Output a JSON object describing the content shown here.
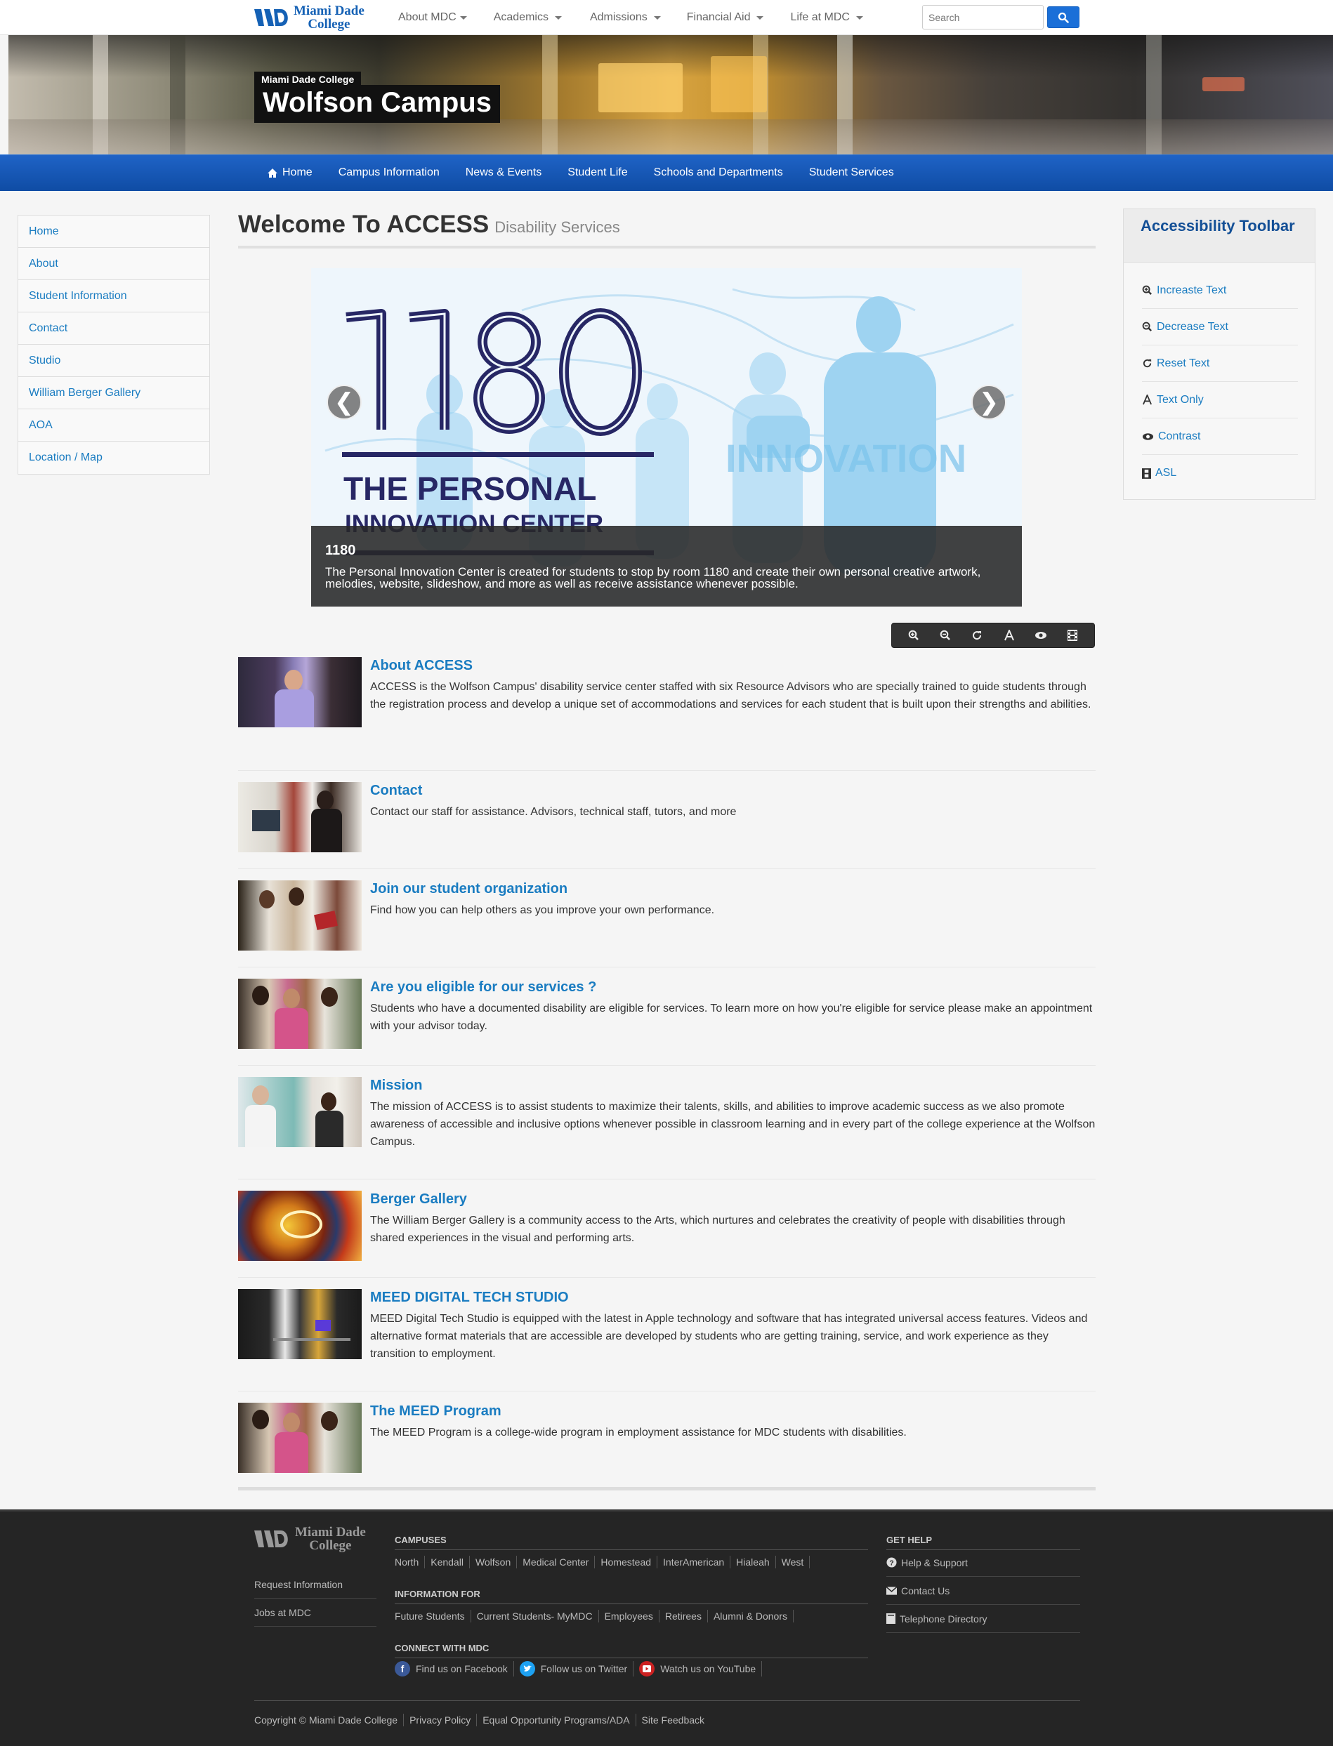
{
  "brand": {
    "line1": "Miami Dade",
    "line2": "College"
  },
  "topnav": [
    {
      "label": "About MDC"
    },
    {
      "label": "Academics"
    },
    {
      "label": "Admissions"
    },
    {
      "label": "Financial Aid"
    },
    {
      "label": "Life at MDC"
    }
  ],
  "search": {
    "placeholder": "Search"
  },
  "banner": {
    "small": "Miami Dade College",
    "title": "Wolfson Campus"
  },
  "mainnav": [
    {
      "label": "Home"
    },
    {
      "label": "Campus Information"
    },
    {
      "label": "News & Events"
    },
    {
      "label": "Student Life"
    },
    {
      "label": "Schools and Departments"
    },
    {
      "label": "Student Services"
    }
  ],
  "sidebar": [
    {
      "label": "Home"
    },
    {
      "label": "About"
    },
    {
      "label": "Student Information"
    },
    {
      "label": "Contact"
    },
    {
      "label": "Studio"
    },
    {
      "label": "William Berger Gallery"
    },
    {
      "label": "AOA"
    },
    {
      "label": "Location / Map"
    }
  ],
  "heading": {
    "title": "Welcome To ACCESS",
    "subtitle": "Disability Services"
  },
  "carousel": {
    "number": "1180",
    "art_line1": "THE PERSONAL",
    "art_line2": "INNOVATION CENTER",
    "caption_title": "1180",
    "caption_text": "The Personal Innovation Center is created for students to stop by room 1180 and create their own personal creative artwork, melodies, website, slideshow, and more as well as receive assistance whenever possible.",
    "prev": "❮",
    "next": "❯"
  },
  "items": [
    {
      "title": "About ACCESS",
      "text": "ACCESS is the Wolfson Campus' disability service center staffed with six Resource Advisors who are specially trained to guide students through the registration process and develop a unique set of accommodations and services for each student that is built upon their strengths and abilities."
    },
    {
      "title": "Contact",
      "text": "Contact our staff for assistance. Advisors, technical staff, tutors, and more"
    },
    {
      "title": "Join our student organization",
      "text": "Find how you can help others as you improve your own performance."
    },
    {
      "title": "Are you eligible for our services ?",
      "text": "Students who have a documented disability are eligible for services. To learn more on how you're eligible for service please make an appointment with your advisor today."
    },
    {
      "title": "Mission",
      "text": "The mission of ACCESS is to assist students to maximize their talents, skills, and abilities to improve academic success as we also promote awareness of accessible and inclusive options whenever possible in classroom learning and in every part of the college experience at the Wolfson Campus."
    },
    {
      "title": "Berger Gallery",
      "text": "The William Berger Gallery is a community access to the Arts, which nurtures and celebrates the creativity of people with disabilities through shared experiences in the visual and performing arts."
    },
    {
      "title": "MEED DIGITAL TECH STUDIO",
      "text": "MEED Digital Tech Studio is equipped with the latest in Apple technology and software that has integrated universal access features. Videos and alternative format materials that are accessible are developed by students who are getting training, service, and work experience as they transition to employment."
    },
    {
      "title": "The MEED Program",
      "text": "The MEED Program is a college-wide program in employment assistance for MDC students with disabilities."
    }
  ],
  "toolbar": {
    "title": "Accessibility Toolbar",
    "items": [
      {
        "label": "Increaste Text",
        "icon": "zoom-in-icon"
      },
      {
        "label": "Decrease Text",
        "icon": "zoom-out-icon"
      },
      {
        "label": "Reset Text",
        "icon": "refresh-icon"
      },
      {
        "label": "Text Only",
        "icon": "font-icon"
      },
      {
        "label": "Contrast",
        "icon": "eye-icon"
      },
      {
        "label": "ASL",
        "icon": "film-icon"
      }
    ]
  },
  "footer": {
    "left_links": [
      {
        "label": "Request Information"
      },
      {
        "label": "Jobs at MDC"
      }
    ],
    "campuses_title": "CAMPUSES",
    "campuses": [
      "North",
      "Kendall",
      "Wolfson",
      "Medical Center",
      "Homestead",
      "InterAmerican",
      "Hialeah",
      "West"
    ],
    "info_title": "INFORMATION FOR",
    "info": [
      "Future Students",
      "Current Students- MyMDC",
      "Employees",
      "Retirees",
      "Alumni & Donors"
    ],
    "connect_title": "CONNECT WITH MDC",
    "connect": [
      {
        "label": "Find us on Facebook",
        "icon": "facebook-icon",
        "color": "#3b5998"
      },
      {
        "label": "Follow us on Twitter",
        "icon": "twitter-icon",
        "color": "#1da1f2"
      },
      {
        "label": "Watch us on YouTube",
        "icon": "youtube-icon",
        "color": "#cc2222"
      }
    ],
    "help_title": "GET HELP",
    "help": [
      {
        "label": "Help & Support",
        "icon": "question-icon"
      },
      {
        "label": "Contact Us",
        "icon": "envelope-icon"
      },
      {
        "label": "Telephone Directory",
        "icon": "book-icon"
      }
    ],
    "bottom": [
      "Copyright © Miami Dade College",
      "Privacy Policy",
      "Equal Opportunity Programs/ADA",
      "Site Feedback"
    ]
  },
  "colors": {
    "nav_blue": "#1458b8",
    "link_blue": "#1a7cc1",
    "toolbar_title": "#134f96",
    "footer_bg": "#252525"
  }
}
